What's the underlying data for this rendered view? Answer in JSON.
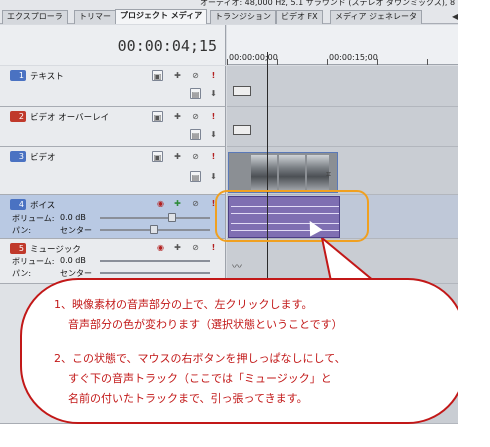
{
  "audio_info": "オーディオ: 48,000 Hz, 5.1 サラウンド (ステレオ ダウンミックス), 8",
  "tabs": [
    {
      "label": "エクスプローラ"
    },
    {
      "label": "トリマー"
    },
    {
      "label": "プロジェクト メディア"
    },
    {
      "label": "トランジション"
    },
    {
      "label": "ビデオ FX"
    },
    {
      "label": "メディア ジェネレータ"
    }
  ],
  "tab_arrow": "◀▶",
  "timecode": "00:00:04;15",
  "ruler": {
    "t0": "00:00:00;00",
    "t1": "00:00:15;00"
  },
  "tracks": [
    {
      "number": "1",
      "name": "テキスト",
      "color": "#4a72c2"
    },
    {
      "number": "2",
      "name": "ビデオ オーバーレイ",
      "color": "#c0392b"
    },
    {
      "number": "3",
      "name": "ビデオ",
      "color": "#4a72c2"
    },
    {
      "number": "4",
      "name": "ボイス",
      "color": "#4a72c2",
      "volume_label": "ボリューム:",
      "volume_value": "0.0 dB",
      "pan_label": "パン:",
      "pan_value": "センター"
    },
    {
      "number": "5",
      "name": "ミュージック",
      "color": "#c0392b",
      "volume_label": "ボリューム:",
      "volume_value": "0.0 dB",
      "pan_label": "パン:",
      "pan_value": "センター"
    }
  ],
  "accent_orange": "#f0a020",
  "accent_red": "#c21818",
  "callout": {
    "line1": "1、映像素材の音声部分の上で、左クリックします。",
    "line2": "音声部分の色が変わります（選択状態ということです）",
    "line3": "2、この状態で、マウスの右ボタンを押しっぱなしにして、",
    "line4": "すぐ下の音声トラック（ここでは「ミュージック」と",
    "line5": "名前の付いたトラックまで、引っ張ってきます。"
  }
}
